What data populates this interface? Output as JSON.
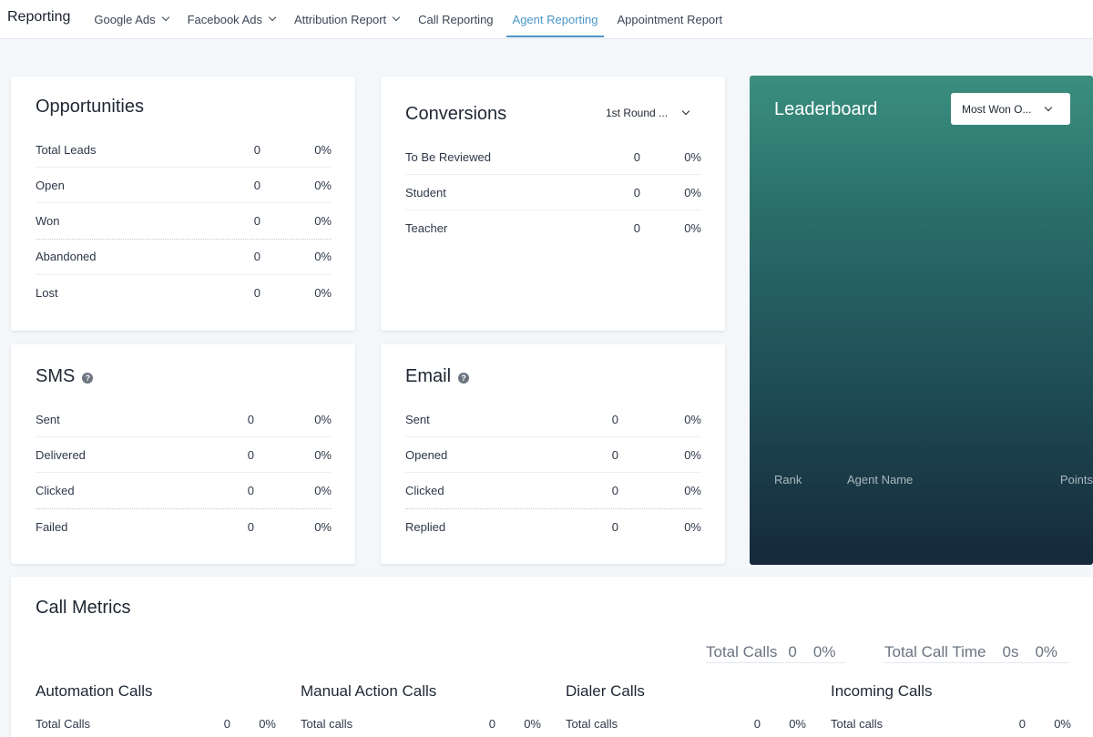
{
  "nav": {
    "brand": "Reporting",
    "tabs": [
      {
        "label": "Google Ads"
      },
      {
        "label": "Facebook Ads"
      },
      {
        "label": "Attribution Report"
      },
      {
        "label": "Call Reporting"
      },
      {
        "label": "Agent Reporting"
      },
      {
        "label": "Appointment Report"
      }
    ]
  },
  "opportunities": {
    "title": "Opportunities",
    "rows": [
      {
        "label": "Total Leads",
        "value": "0",
        "percent": "0%"
      },
      {
        "label": "Open",
        "value": "0",
        "percent": "0%"
      },
      {
        "label": "Won",
        "value": "0",
        "percent": "0%"
      },
      {
        "label": "Abandoned",
        "value": "0",
        "percent": "0%"
      },
      {
        "label": "Lost",
        "value": "0",
        "percent": "0%"
      }
    ]
  },
  "conversions": {
    "title": "Conversions",
    "dropdown": "1st Round ...",
    "rows": [
      {
        "label": "To Be Reviewed",
        "value": "0",
        "percent": "0%"
      },
      {
        "label": "Student",
        "value": "0",
        "percent": "0%"
      },
      {
        "label": "Teacher",
        "value": "0",
        "percent": "0%"
      }
    ]
  },
  "sms": {
    "title": "SMS",
    "rows": [
      {
        "label": "Sent",
        "value": "0",
        "percent": "0%"
      },
      {
        "label": "Delivered",
        "value": "0",
        "percent": "0%"
      },
      {
        "label": "Clicked",
        "value": "0",
        "percent": "0%"
      },
      {
        "label": "Failed",
        "value": "0",
        "percent": "0%"
      }
    ]
  },
  "email": {
    "title": "Email",
    "rows": [
      {
        "label": "Sent",
        "value": "0",
        "percent": "0%"
      },
      {
        "label": "Opened",
        "value": "0",
        "percent": "0%"
      },
      {
        "label": "Clicked",
        "value": "0",
        "percent": "0%"
      },
      {
        "label": "Replied",
        "value": "0",
        "percent": "0%"
      }
    ]
  },
  "leaderboard": {
    "title": "Leaderboard",
    "dropdown": "Most Won O...",
    "columns": [
      "Rank",
      "Agent Name",
      "Points"
    ]
  },
  "call_metrics": {
    "title": "Call Metrics",
    "summary": {
      "total_calls_label": "Total Calls",
      "total_calls_value": "0",
      "total_calls_percent": "0%",
      "total_time_label": "Total Call Time",
      "total_time_value": "0s",
      "total_time_percent": "0%"
    },
    "groups": [
      {
        "title": "Automation Calls",
        "row_label": "Total Calls",
        "value": "0",
        "percent": "0%"
      },
      {
        "title": "Manual Action Calls",
        "row_label": "Total calls",
        "value": "0",
        "percent": "0%"
      },
      {
        "title": "Dialer Calls",
        "row_label": "Total calls",
        "value": "0",
        "percent": "0%"
      },
      {
        "title": "Incoming Calls",
        "row_label": "Total calls",
        "value": "0",
        "percent": "0%"
      }
    ]
  },
  "icons": {
    "help": "question-circle-icon",
    "dropdown": "chevron-down-icon"
  },
  "colors": {
    "accent": "#4a96c8",
    "leaderboard_top": "#3a8f7f",
    "leaderboard_bottom": "#15293a"
  }
}
